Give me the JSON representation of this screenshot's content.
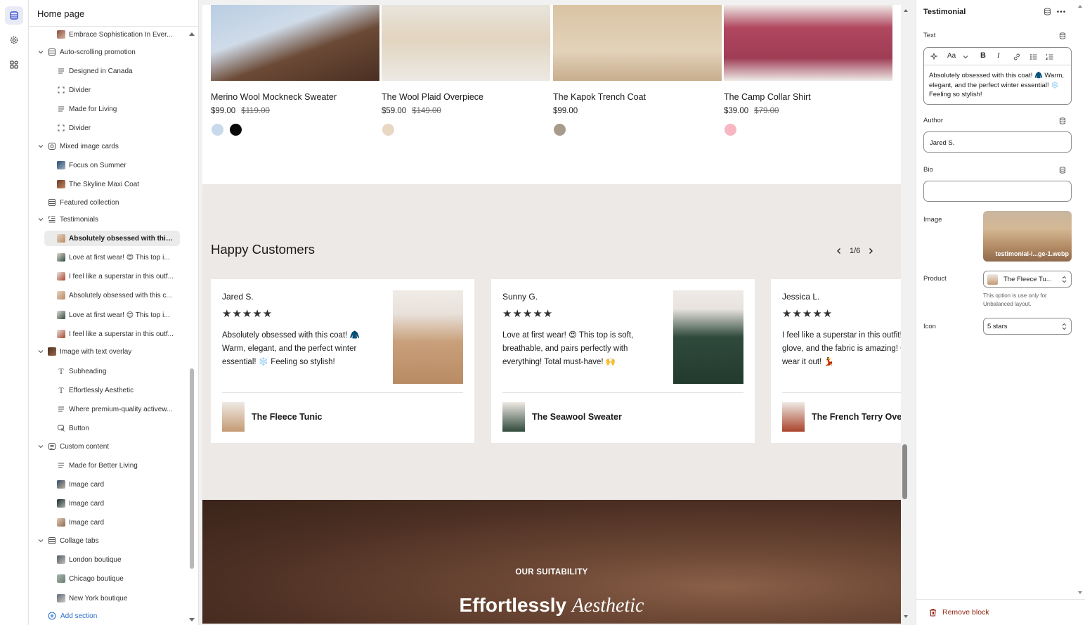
{
  "sidebar": {
    "title": "Home page",
    "items": [
      {
        "label": "Embrace Sophistication In Ever..."
      },
      {
        "label": "Auto-scrolling promotion"
      },
      {
        "label": "Designed in Canada"
      },
      {
        "label": "Divider"
      },
      {
        "label": "Made for Living"
      },
      {
        "label": "Divider"
      },
      {
        "label": "Mixed image cards"
      },
      {
        "label": "Focus on Summer"
      },
      {
        "label": "The Skyline Maxi Coat"
      },
      {
        "label": "Featured collection"
      },
      {
        "label": "Testimonials"
      },
      {
        "label": "Absolutely obsessed with this ..."
      },
      {
        "label": "Love at first wear! 😍 This top i..."
      },
      {
        "label": "I feel like a superstar in this outf..."
      },
      {
        "label": "Absolutely obsessed with this c..."
      },
      {
        "label": "Love at first wear! 😍 This top i..."
      },
      {
        "label": "I feel like a superstar in this outf..."
      },
      {
        "label": "Image with text overlay"
      },
      {
        "label": "Subheading"
      },
      {
        "label": "Effortlessly Aesthetic"
      },
      {
        "label": "Where premium-quality activew..."
      },
      {
        "label": "Button"
      },
      {
        "label": "Custom content"
      },
      {
        "label": "Made for Better Living"
      },
      {
        "label": "Image card"
      },
      {
        "label": "Image card"
      },
      {
        "label": "Image card"
      },
      {
        "label": "Collage tabs"
      },
      {
        "label": "London boutique"
      },
      {
        "label": "Chicago boutique"
      },
      {
        "label": "New York boutique"
      }
    ],
    "add_section": "Add section"
  },
  "preview": {
    "products": [
      {
        "name": "Merino Wool Mockneck Sweater",
        "price": "$99.00",
        "compare": "$119.00",
        "swatches": [
          "#c9d9ec",
          "#0a0a0a"
        ]
      },
      {
        "name": "The Wool Plaid Overpiece",
        "price": "$59.00",
        "compare": "$149.00",
        "swatches": [
          "#e8d7c3"
        ]
      },
      {
        "name": "The Kapok Trench Coat",
        "price": "$99.00",
        "compare": "",
        "swatches": [
          "#a79b8c"
        ]
      },
      {
        "name": "The Camp Collar Shirt",
        "price": "$39.00",
        "compare": "$79.00",
        "swatches": [
          "#f7b6c2"
        ]
      }
    ],
    "testimonials_heading": "Happy Customers",
    "pager": "1/6",
    "cards": [
      {
        "author": "Jared S.",
        "stars": "★★★★★",
        "quote": "Absolutely obsessed with this coat! 🧥 Warm, elegant, and the perfect winter essential! ❄️ Feeling so stylish!",
        "product": "The Fleece Tunic"
      },
      {
        "author": "Sunny G.",
        "stars": "★★★★★",
        "quote": "Love at first wear! 😍 This top is soft, breathable, and pairs perfectly with everything! Total must-have! 🙌",
        "product": "The Seawool Sweater"
      },
      {
        "author": "Jessica L.",
        "stars": "★★★★★",
        "quote": "I feel like a superstar in this outfit! Fits like a glove, and the fabric is amazing! Can't wait to wear it out! 💃",
        "product": "The French Terry Overshirt"
      }
    ],
    "overlay": {
      "subheading": "OUR SUITABILITY",
      "heading_plain": "Effortlessly",
      "heading_italic": "Aesthetic"
    }
  },
  "inspector": {
    "title": "Testimonial",
    "text_label": "Text",
    "text_value": "Absolutely obsessed with this coat! 🧥 Warm, elegant, and the perfect winter essential! ❄️ Feeling so stylish!",
    "author_label": "Author",
    "author_value": "Jared S.",
    "bio_label": "Bio",
    "bio_value": "",
    "image_label": "Image",
    "image_filename": "testimonial-i...ge-1.webp",
    "product_label": "Product",
    "product_value": "The Fleece Tu...",
    "product_help": "This option is use only for Unbalanced layout.",
    "icon_label": "Icon",
    "icon_value": "5 stars",
    "remove_label": "Remove block"
  }
}
